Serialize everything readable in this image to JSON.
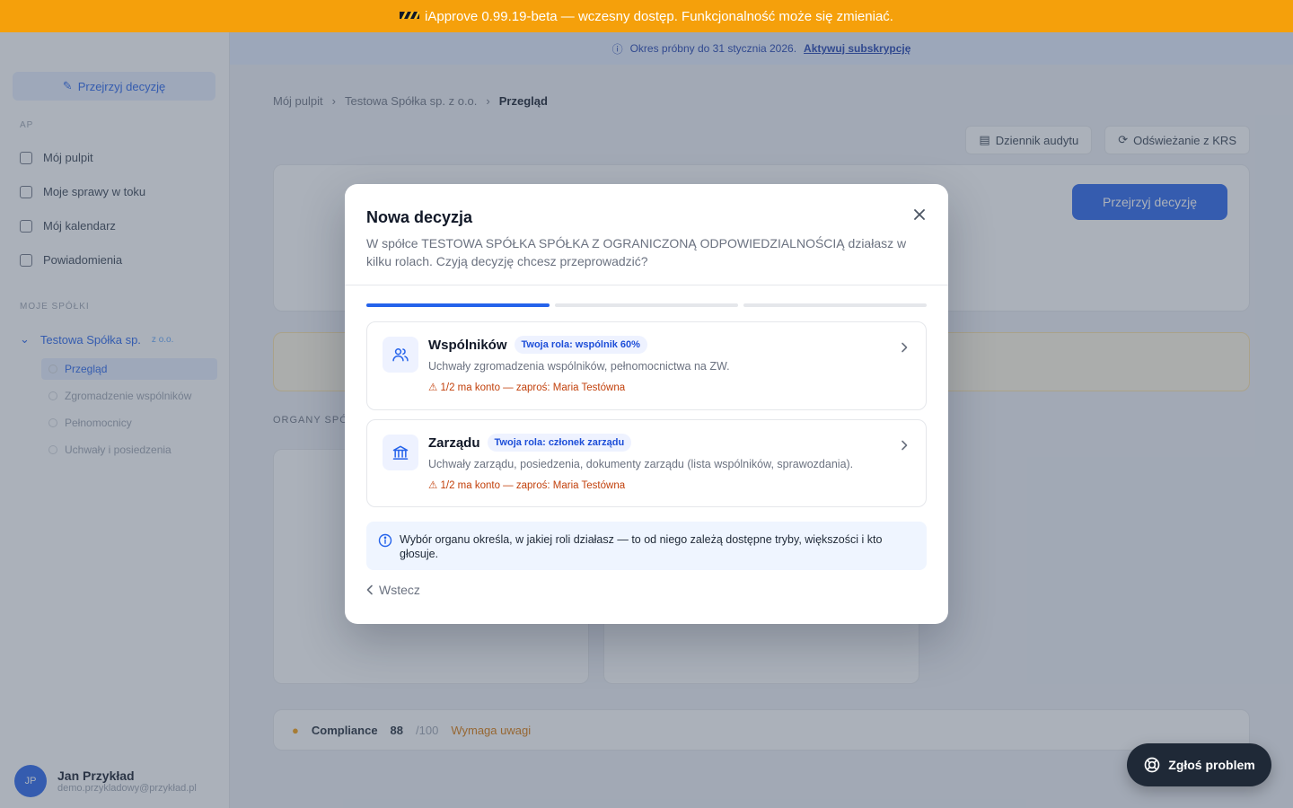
{
  "banner": {
    "text": "iApprove 0.99.19-beta — wczesny dostęp. Funkcjonalność może się zmieniać."
  },
  "background": {
    "sidebar": {
      "new_decision": "Przejrzyj decyzję",
      "section_label": "AP",
      "nav": [
        {
          "label": "Mój pulpit"
        },
        {
          "label": "Moje sprawy w toku"
        },
        {
          "label": "Mój kalendarz"
        },
        {
          "label": "Powiadomienia"
        }
      ],
      "companies_label": "MOJE SPÓŁKI",
      "company_name": "Testowa Spółka sp.",
      "company_suffix": "z o.o.",
      "sub_items": [
        {
          "label": "Przegląd"
        },
        {
          "label": "Zgromadzenie wspólników"
        },
        {
          "label": "Pełnomocnicy"
        },
        {
          "label": "Uchwały i posiedzenia"
        }
      ],
      "user_initials": "JP",
      "user_name": "Jan Przykład",
      "user_email": "demo.przykladowy@przykład.pl"
    },
    "info_bar": {
      "text": "Okres próbny do 31 stycznia 2026.",
      "link": "Aktywuj subskrypcję"
    },
    "breadcrumb": {
      "a": "Mój pulpit",
      "b": "Testowa Spółka sp. z o.o.",
      "c": "Przegląd"
    },
    "actions": {
      "log": "Dziennik audytu",
      "export": "Odświeżanie z KRS"
    },
    "primary": "Przejrzyj decyzję",
    "section": "ORGANY SPÓŁKI",
    "compliance": {
      "label": "Compliance",
      "value": "88",
      "unit": "/100",
      "status": "Wymaga uwagi"
    }
  },
  "modal": {
    "title": "Nowa decyzja",
    "subtitle": "W spółce TESTOWA SPÓŁKA SPÓŁKA Z OGRANICZONĄ ODPOWIEDZIALNOŚCIĄ działasz w kilku rolach. Czyją decyzję chcesz przeprowadzić?",
    "steps": [
      {
        "active": true
      },
      {
        "active": false
      },
      {
        "active": false
      }
    ],
    "options": [
      {
        "name": "Wspólników",
        "badge": "Twoja rola: wspólnik 60%",
        "description": "Uchwały zgromadzenia wspólników, pełnomocnictwa na ZW.",
        "warning": "⚠ 1/2 ma konto — zaproś: Maria Testówna",
        "icon": "users-icon"
      },
      {
        "name": "Zarządu",
        "badge": "Twoja rola: członek zarządu",
        "description": "Uchwały zarządu, posiedzenia, dokumenty zarządu (lista wspólników, sprawozdania).",
        "warning": "⚠ 1/2 ma konto — zaproś: Maria Testówna",
        "icon": "bank-icon"
      }
    ],
    "tip": "Wybór organu określa, w jakiej roli działasz — to od niego zależą dostępne tryby, większości i kto głosuje.",
    "back": "Wstecz"
  },
  "report_button": "Zgłoś problem",
  "colors": {
    "accent": "#2563eb",
    "banner": "#f5a00b",
    "warning": "#c2410c"
  }
}
